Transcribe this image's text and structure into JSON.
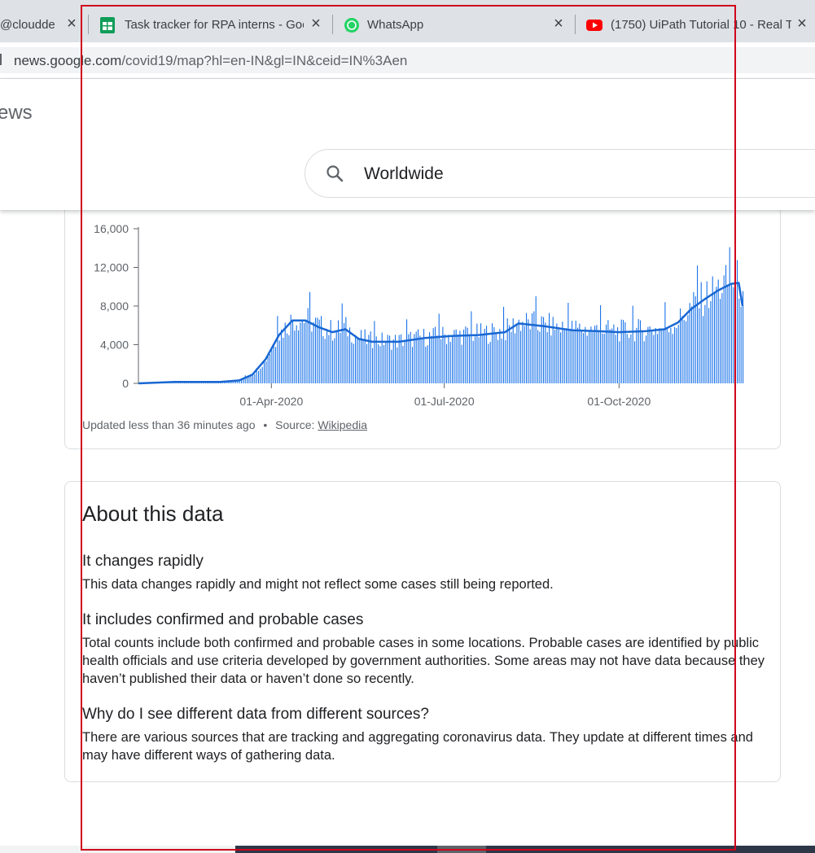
{
  "browser": {
    "tabs": [
      {
        "title": "@cloudde",
        "close": "×",
        "icon": "generic"
      },
      {
        "title": "Task tracker for RPA interns - Goo",
        "close": "×",
        "icon": "sheets-icon"
      },
      {
        "title": "WhatsApp",
        "close": "×",
        "icon": "whatsapp-icon"
      },
      {
        "title": "(1750) UiPath Tutorial 10 - Real T",
        "close": "×",
        "icon": "youtube-icon"
      }
    ],
    "url_domain": "news.google.com",
    "url_path": "/covid19/map?hl=en-IN&gl=IN&ceid=IN%3Aen"
  },
  "header": {
    "brand_fragment": "ews",
    "search_value": "Worldwide"
  },
  "chart_data": {
    "type": "bar",
    "series": [
      {
        "kind": "daily bars",
        "color": "#1a73e8"
      },
      {
        "kind": "7-day average line",
        "color": "#1967d2"
      }
    ],
    "x_range": [
      "2020-01-22",
      "2020-12-05"
    ],
    "x_ticks": [
      "01-Apr-2020",
      "01-Jul-2020",
      "01-Oct-2020"
    ],
    "y_ticks": [
      "0",
      "4,000",
      "8,000",
      "12,000",
      "16,000"
    ],
    "ylim": [
      0,
      16000
    ],
    "trend_points": [
      {
        "x": "2020-01-22",
        "y": 0
      },
      {
        "x": "2020-02-10",
        "y": 150
      },
      {
        "x": "2020-03-05",
        "y": 150
      },
      {
        "x": "2020-03-15",
        "y": 300
      },
      {
        "x": "2020-03-22",
        "y": 900
      },
      {
        "x": "2020-03-29",
        "y": 2500
      },
      {
        "x": "2020-04-05",
        "y": 5000
      },
      {
        "x": "2020-04-12",
        "y": 6500
      },
      {
        "x": "2020-04-19",
        "y": 6500
      },
      {
        "x": "2020-04-26",
        "y": 5800
      },
      {
        "x": "2020-05-03",
        "y": 5300
      },
      {
        "x": "2020-05-10",
        "y": 5600
      },
      {
        "x": "2020-05-17",
        "y": 4600
      },
      {
        "x": "2020-05-24",
        "y": 4300
      },
      {
        "x": "2020-06-07",
        "y": 4300
      },
      {
        "x": "2020-06-21",
        "y": 4700
      },
      {
        "x": "2020-07-05",
        "y": 4900
      },
      {
        "x": "2020-07-19",
        "y": 5000
      },
      {
        "x": "2020-08-02",
        "y": 5300
      },
      {
        "x": "2020-08-09",
        "y": 6200
      },
      {
        "x": "2020-08-23",
        "y": 5900
      },
      {
        "x": "2020-09-06",
        "y": 5500
      },
      {
        "x": "2020-09-20",
        "y": 5400
      },
      {
        "x": "2020-10-01",
        "y": 5300
      },
      {
        "x": "2020-10-15",
        "y": 5400
      },
      {
        "x": "2020-10-25",
        "y": 5600
      },
      {
        "x": "2020-11-01",
        "y": 6300
      },
      {
        "x": "2020-11-08",
        "y": 7700
      },
      {
        "x": "2020-11-15",
        "y": 8700
      },
      {
        "x": "2020-11-22",
        "y": 9600
      },
      {
        "x": "2020-11-29",
        "y": 10300
      },
      {
        "x": "2020-12-03",
        "y": 10400
      },
      {
        "x": "2020-12-05",
        "y": 8000
      }
    ],
    "grid": false,
    "legend": "none"
  },
  "chart_footer": {
    "updated": "Updated less than 36 minutes ago",
    "dot": "•",
    "source_label": "Source:",
    "source_link": "Wikipedia"
  },
  "about": {
    "title": "About this data",
    "sections": [
      {
        "heading": "It changes rapidly",
        "body": "This data changes rapidly and might not reflect some cases still being reported."
      },
      {
        "heading": "It includes confirmed and probable cases",
        "body": "Total counts include both confirmed and probable cases in some locations. Probable cases are identified by public health officials and use criteria developed by government authorities. Some areas may not have data because they haven’t published their data or haven’t done so recently."
      },
      {
        "heading": "Why do I see different data from different sources?",
        "body": "There are various sources that are tracking and aggregating coronavirus data. They update at different times and may have different ways of gathering data."
      }
    ]
  },
  "colors": {
    "accent": "#1a73e8",
    "annotation_box": "#d0021b"
  }
}
